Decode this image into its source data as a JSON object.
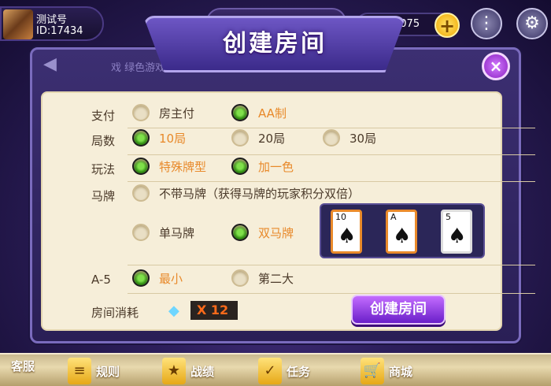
{
  "player": {
    "name": "测试号",
    "id": "ID:17434"
  },
  "currency": {
    "amount": "1075",
    "plus": "+"
  },
  "marquee": "戏 绿色游戏 抵制 合理安排时间 健康",
  "dialog": {
    "title": "创建房间",
    "close": "×"
  },
  "rows": {
    "pay": {
      "label": "支付",
      "options": [
        "房主付",
        "AA制"
      ],
      "selected": 1
    },
    "rounds": {
      "label": "局数",
      "options": [
        "10局",
        "20局",
        "30局"
      ],
      "selected": 0
    },
    "rules": {
      "label": "玩法",
      "options": [
        "特殊牌型",
        "加一色"
      ],
      "selected": [
        0,
        1
      ]
    },
    "horse": {
      "label": "马牌",
      "options": [
        "不带马牌（获得马牌的玩家积分双倍）",
        "单马牌",
        "双马牌"
      ],
      "selected": 2,
      "cards": [
        {
          "rank": "10",
          "suit": "♠"
        },
        {
          "rank": "A",
          "suit": "♠"
        },
        {
          "rank": "5",
          "suit": "♠"
        }
      ]
    },
    "a5": {
      "label": "A-5",
      "options": [
        "最小",
        "第二大"
      ],
      "selected": 0
    }
  },
  "cost": {
    "label": "房间消耗",
    "value": "X 12"
  },
  "create_button": "创建房间",
  "bottom_nav": [
    {
      "label": "客服",
      "icon": "customer-service-icon",
      "glyph": "☎"
    },
    {
      "label": "规则",
      "icon": "rules-icon",
      "glyph": "≡"
    },
    {
      "label": "战绩",
      "icon": "record-icon",
      "glyph": "★"
    },
    {
      "label": "任务",
      "icon": "task-icon",
      "glyph": "✓"
    },
    {
      "label": "商城",
      "icon": "shop-icon",
      "glyph": "🛒"
    }
  ]
}
